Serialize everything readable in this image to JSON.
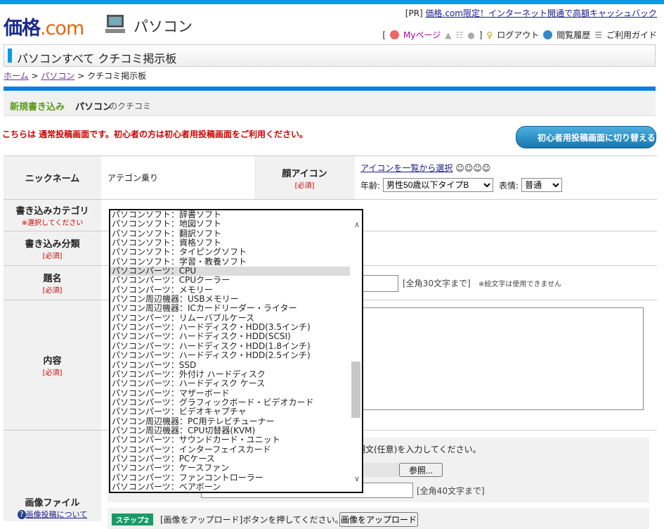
{
  "header": {
    "logo_main": "価格",
    "logo_com": ".com",
    "section": "パソコン",
    "pr_tag": "[PR]",
    "pr_link": "価格.com限定！インターネット開通で高額キャッシュバック",
    "util": {
      "bracket_open": "[",
      "mypage": "Myページ",
      "bracket_close": "]",
      "logout": "ログアウト",
      "history": "閲覧履歴",
      "guide": "ご利用ガイド"
    }
  },
  "page_title": "パソコンすべて クチコミ掲示板",
  "breadcrumb": {
    "home": "ホーム",
    "pc": "パソコン",
    "sep": ">",
    "current": "クチコミ掲示板"
  },
  "subhead": {
    "new_post": "新規書き込み",
    "category": "パソコン",
    "suffix": "のクチコミ"
  },
  "notice": "こちらは 通常投稿画面です。初心者の方は初心者用投稿画面をご利用ください。",
  "beginner_button": "初心者用投稿画面に切り替える",
  "form": {
    "nickname_label": "ニックネーム",
    "nickname_value": "アテゴン乗り",
    "face_label": "顔アイコン",
    "required": "[必須]",
    "icon_link": "アイコンを一覧から選択",
    "age_label": "年齢:",
    "age_value": "男性50歳以下タイプB",
    "expr_label": "表情:",
    "expr_value": "普通",
    "category_label": "書き込みカテゴリ",
    "category_note": "※選択してください",
    "type_label": "書き込み分類",
    "title_label": "題名",
    "title_limit": "[全角30文字まで]",
    "title_note": "※絵文字は使用できません",
    "content_label": "内容",
    "image_label": "画像ファイル",
    "image_help": "画像投稿について",
    "image_desc_hint": "明文(任意)を入力してください。",
    "browse": "参照...",
    "caption_limit": "[全角40文字まで]",
    "step2": "ステップ2",
    "step2_text": "[画像をアップロード]ボタンを押してください。",
    "upload_button": "画像をアップロード"
  },
  "category_options": [
    "パソコンソフト：辞書ソフト",
    "パソコンソフト：地図ソフト",
    "パソコンソフト：翻訳ソフト",
    "パソコンソフト：資格ソフト",
    "パソコンソフト：タイピングソフト",
    "パソコンソフト：学習・教養ソフト",
    "パソコンパーツ：CPU",
    "パソコンパーツ：CPUクーラー",
    "パソコンパーツ：メモリー",
    "パソコン周辺機器：USBメモリー",
    "パソコン周辺機器：ICカードリーダー・ライター",
    "パソコンパーツ：リムーバブルケース",
    "パソコンパーツ：ハードディスク・HDD(3.5インチ)",
    "パソコンパーツ：ハードディスク・HDD(SCSI)",
    "パソコンパーツ：ハードディスク・HDD(1.8インチ)",
    "パソコンパーツ：ハードディスク・HDD(2.5インチ)",
    "パソコンパーツ：SSD",
    "パソコンパーツ：外付け ハードディスク",
    "パソコンパーツ：ハードディスク ケース",
    "パソコンパーツ：マザーボード",
    "パソコンパーツ：グラフィックボード・ビデオカード",
    "パソコンパーツ：ビデオキャプチャ",
    "パソコン周辺機器：PC用テレビチューナー",
    "パソコン周辺機器：CPU切替器(KVM)",
    "パソコンパーツ：サウンドカード・ユニット",
    "パソコンパーツ：インターフェイスカード",
    "パソコンパーツ：PCケース",
    "パソコンパーツ：ケースファン",
    "パソコンパーツ：ファンコントローラー",
    "パソコンパーツ：ベアボーン"
  ],
  "selected_option": "パソコンパーツ：CPU"
}
